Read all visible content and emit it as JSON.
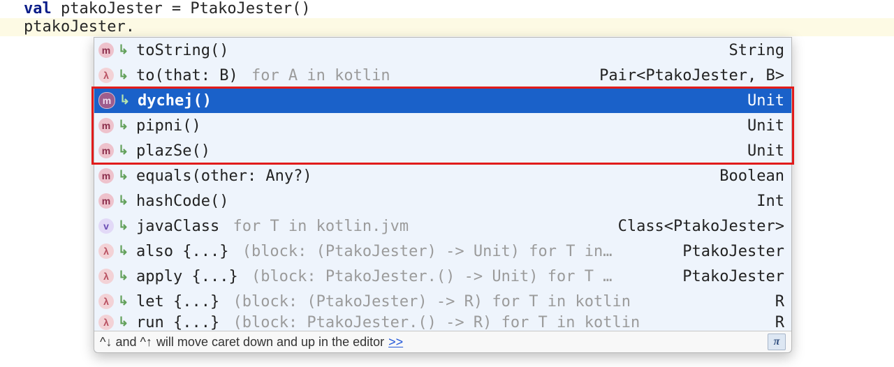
{
  "code": {
    "line1_kw": "val",
    "line1_rest": " ptakoJester = PtakoJester()",
    "line2": "ptakoJester."
  },
  "popup": {
    "rows": [
      {
        "kind": "m",
        "sig": "toString()",
        "hint": "",
        "ret": "String",
        "sel": false
      },
      {
        "kind": "l",
        "sig": "to(that: B)",
        "hint": " for A in kotlin",
        "ret": "Pair<PtakoJester, B>",
        "sel": false
      },
      {
        "kind": "m",
        "sig": "dychej()",
        "hint": "",
        "ret": "Unit",
        "sel": true
      },
      {
        "kind": "m",
        "sig": "pipni()",
        "hint": "",
        "ret": "Unit",
        "sel": false
      },
      {
        "kind": "m",
        "sig": "plazSe()",
        "hint": "",
        "ret": "Unit",
        "sel": false
      },
      {
        "kind": "m",
        "sig": "equals(other: Any?)",
        "hint": "",
        "ret": "Boolean",
        "sel": false
      },
      {
        "kind": "m",
        "sig": "hashCode()",
        "hint": "",
        "ret": "Int",
        "sel": false
      },
      {
        "kind": "v",
        "sig": "javaClass",
        "hint": " for T in kotlin.jvm",
        "ret": "Class<PtakoJester>",
        "sel": false
      },
      {
        "kind": "l",
        "sig": "also {...}",
        "hint": " (block: (PtakoJester) -> Unit) for T in…",
        "ret": "PtakoJester",
        "sel": false
      },
      {
        "kind": "l",
        "sig": "apply {...}",
        "hint": " (block: PtakoJester.() -> Unit) for T …",
        "ret": "PtakoJester",
        "sel": false
      },
      {
        "kind": "l",
        "sig": "let {...}",
        "hint": " (block: (PtakoJester) -> R) for T in kotlin",
        "ret": "R",
        "sel": false
      },
      {
        "kind": "l",
        "sig": "run {...}",
        "hint": " (block: PtakoJester.() -> R) for T in kotlin",
        "ret": "R",
        "sel": false,
        "cutoff": true
      }
    ],
    "hint_prefix": "^↓ and ^↑ ",
    "hint_text": "will move caret down and up in the editor",
    "hint_link": ">>",
    "pi": "π"
  },
  "icon_letters": {
    "m": "m",
    "l": "λ",
    "v": "v"
  }
}
